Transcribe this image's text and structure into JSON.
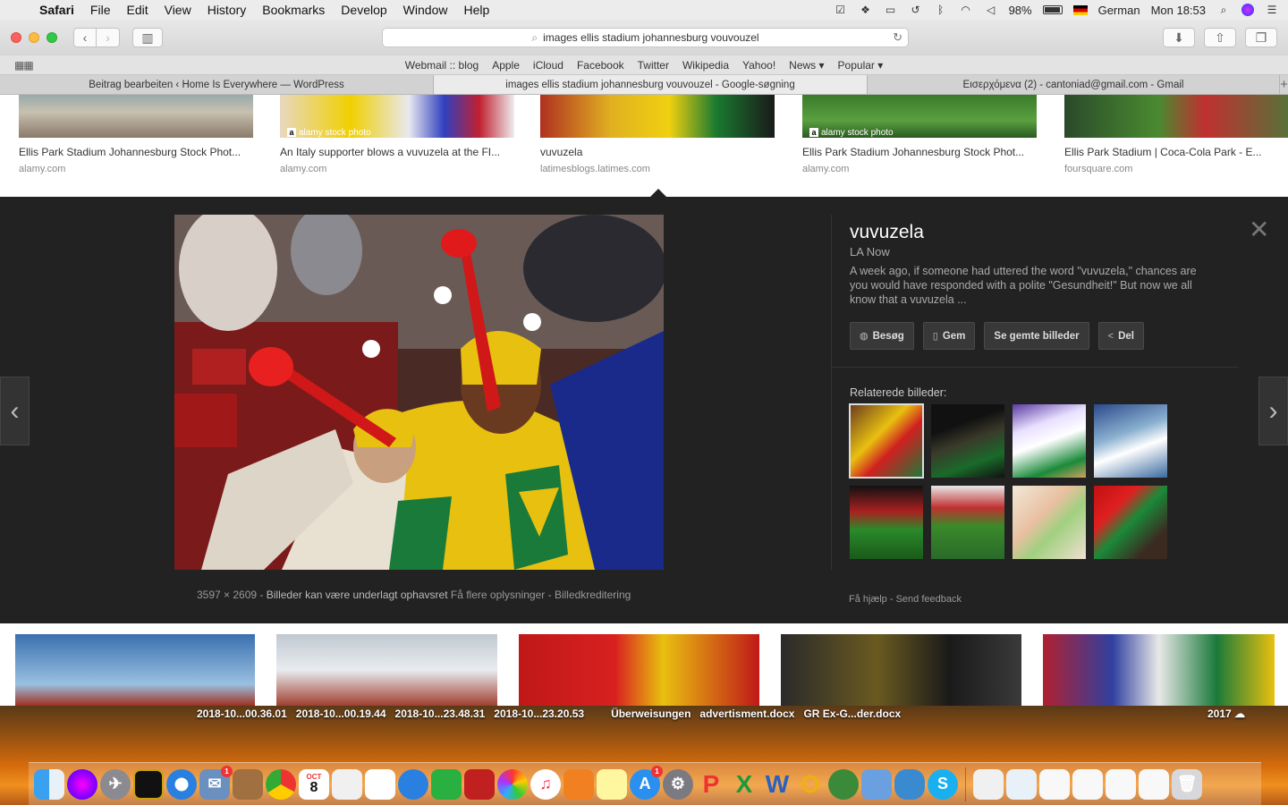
{
  "menubar": {
    "app": "Safari",
    "items": [
      "File",
      "Edit",
      "View",
      "History",
      "Bookmarks",
      "Develop",
      "Window",
      "Help"
    ],
    "battery": "98%",
    "input_source": "German",
    "clock": "Mon 18:53"
  },
  "toolbar": {
    "address": "images ellis stadium johannesburg vouvouzel"
  },
  "favorites": [
    "Webmail :: blog",
    "Apple",
    "iCloud",
    "Facebook",
    "Twitter",
    "Wikipedia",
    "Yahoo!",
    "News ▾",
    "Popular ▾"
  ],
  "tabs": [
    {
      "title": "Beitrag bearbeiten ‹ Home Is Everywhere — WordPress"
    },
    {
      "title": "images ellis stadium johannesburg vouvouzel - Google-søgning"
    },
    {
      "title": "Εισερχόμενα (2) - cantoniad@gmail.com - Gmail"
    }
  ],
  "results_top": [
    {
      "title": "Ellis Park Stadium Johannesburg Stock Phot...",
      "source": "alamy.com",
      "label": ""
    },
    {
      "title": "An Italy supporter blows a vuvuzela at the FI...",
      "source": "alamy.com",
      "label": "alamy stock photo"
    },
    {
      "title": "vuvuzela",
      "source": "latimesblogs.latimes.com",
      "label": ""
    },
    {
      "title": "Ellis Park Stadium Johannesburg Stock Phot...",
      "source": "alamy.com",
      "label": "alamy stock photo"
    },
    {
      "title": "Ellis Park Stadium | Coca-Cola Park - E...",
      "source": "foursquare.com",
      "label": ""
    }
  ],
  "viewer": {
    "title": "vuvuzela",
    "source": "LA Now",
    "description": "A week ago, if someone had uttered the word \"vuvuzela,\" chances are you would have responded with a polite \"Gesundheit!\" But now we all know that a vuvuzela ...",
    "actions": [
      "Besøg",
      "Gem",
      "Se gemte billeder",
      "Del"
    ],
    "related_title": "Relaterede billeder:",
    "caption_size": "3597 × 2609",
    "caption_rights": "Billeder kan være underlagt ophavsret",
    "caption_more": "Få flere oplysninger",
    "caption_credit": "Billedkreditering",
    "help": "Få hjælp",
    "feedback": "Send feedback"
  },
  "desktop": {
    "files": [
      "2018-10...00.36.01",
      "2018-10...00.19.44",
      "2018-10...23.48.31",
      "2018-10...23.20.53",
      "Überweisungen",
      "advertisment.docx",
      "GR Ex-G...der.docx"
    ],
    "right_file": "2017"
  },
  "dock": {
    "calendar_month": "OCT",
    "calendar_day": "8",
    "badge": "1"
  }
}
